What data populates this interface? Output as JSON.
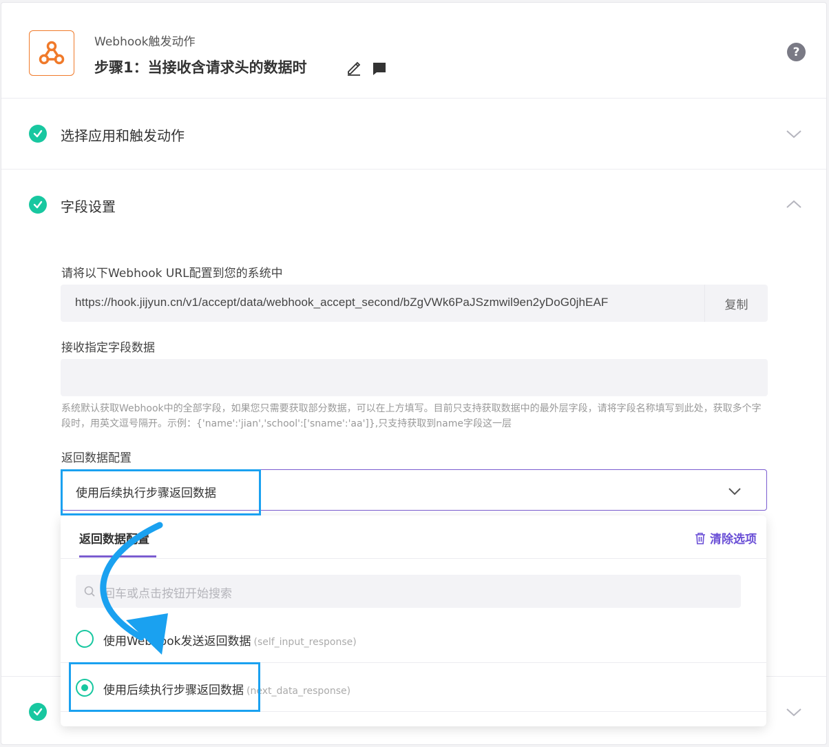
{
  "header": {
    "subtitle": "Webhook触发动作",
    "step_title": "步骤1：当接收含请求头的数据时",
    "help_label": "?"
  },
  "sections": {
    "select_app": "选择应用和触发动作",
    "field_settings": "字段设置"
  },
  "fields": {
    "url_label": "请将以下Webhook URL配置到您的系统中",
    "url_value": "https://hook.jijyun.cn/v1/accept/data/webhook_accept_second/bZgVWk6PaJSzmwil9en2yDoG0jhEAF",
    "copy_label": "复制",
    "receive_label": "接收指定字段数据",
    "receive_value": "",
    "hint": "系统默认获取Webhook中的全部字段，如果您只需要获取部分数据，可以在上方填写。目前只支持获取数据中的最外层字段，请将字段名称填写到此处，获取多个字段时，用英文逗号隔开。示例：{'name':'jian','school':['sname':'aa']},只支持获取到name字段这一层",
    "return_label": "返回数据配置",
    "return_value": "使用后续执行步骤返回数据"
  },
  "dropdown": {
    "tab": "返回数据配置",
    "clear": "清除选项",
    "search_placeholder": "回车或点击按钮开始搜索",
    "options": [
      {
        "label": "使用Webhook发送返回数据",
        "code": "(self_input_response)",
        "selected": false
      },
      {
        "label": "使用后续执行步骤返回数据",
        "code": "(next_data_response)",
        "selected": true
      }
    ]
  },
  "colors": {
    "accent": "#7a5cd0",
    "success": "#18c7a0",
    "brand_orange": "#f07a2a",
    "annotation_blue": "#1aa1f0"
  }
}
